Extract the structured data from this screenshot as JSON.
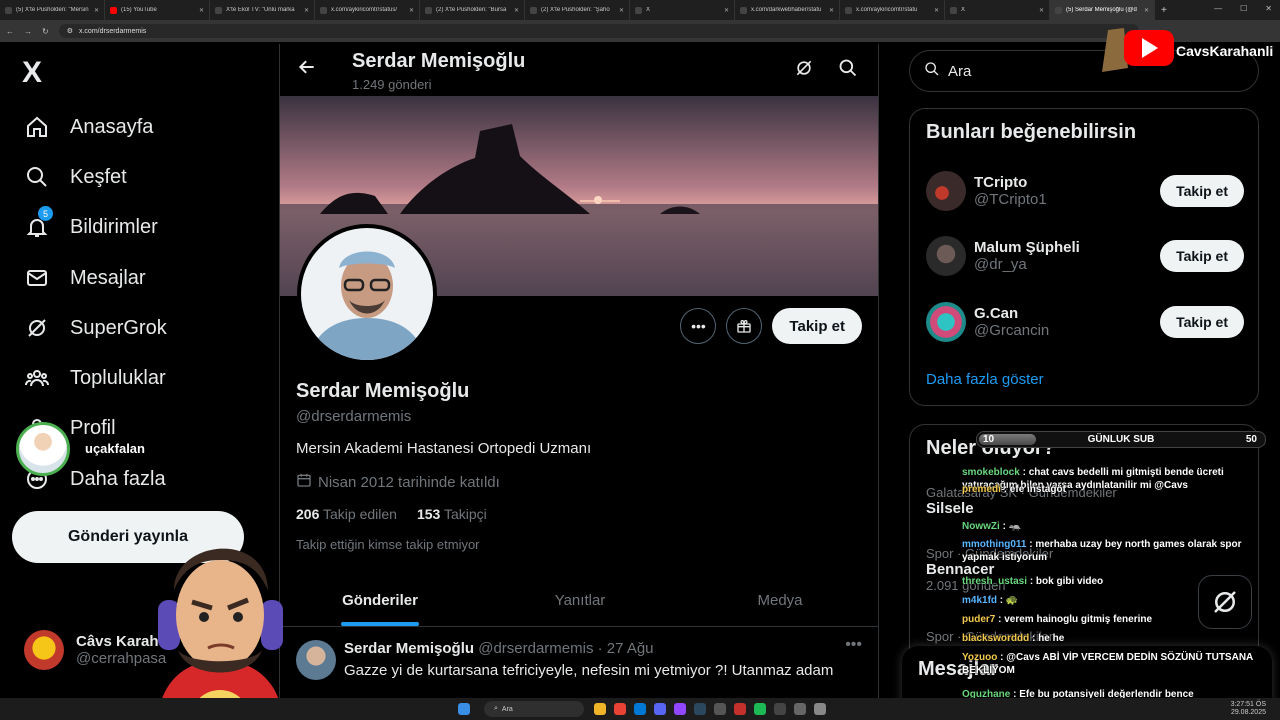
{
  "browser": {
    "tabs": [
      {
        "title": "(5) X'te Pusholden: \"Mersin",
        "fav": "#444"
      },
      {
        "title": "(15) YouTube",
        "fav": "#ff0000"
      },
      {
        "title": "X'te Ekol TV: \"Ünlü marka",
        "fav": "#444"
      },
      {
        "title": "x.com/aykiricomtr/status/",
        "fav": "#444"
      },
      {
        "title": "(2) X'te Pusholden: \"Bursa",
        "fav": "#444"
      },
      {
        "title": "(2) X'te Pusholden: \"Şaho",
        "fav": "#444"
      },
      {
        "title": "X",
        "fav": "#444"
      },
      {
        "title": "x.com/darkwebhaber/statu",
        "fav": "#444"
      },
      {
        "title": "x.com/aykiricomtr/statu",
        "fav": "#444"
      },
      {
        "title": "X",
        "fav": "#444"
      },
      {
        "title": "(5) Serdar Memişoğlu (@d",
        "fav": "#444"
      }
    ],
    "new_tab": "+",
    "url": "x.com/drserdarmemis"
  },
  "leftnav": {
    "logo": "X",
    "items": [
      {
        "label": "Anasayfa",
        "icon": "home-icon"
      },
      {
        "label": "Keşfet",
        "icon": "search-icon"
      },
      {
        "label": "Bildirimler",
        "icon": "bell-icon",
        "badge": "5"
      },
      {
        "label": "Mesajlar",
        "icon": "mail-icon"
      },
      {
        "label": "SuperGrok",
        "icon": "grok-icon"
      },
      {
        "label": "Topluluklar",
        "icon": "communities-icon"
      },
      {
        "label": "Profil",
        "icon": "person-icon"
      },
      {
        "label": "Daha fazla",
        "icon": "more-circle-icon"
      }
    ],
    "post_button": "Gönderi yayınla",
    "account": {
      "name": "Câvs Karah",
      "handle": "@cerrahpasa"
    }
  },
  "overlay": {
    "viewer_name": "uçakfalan",
    "yt_channel": "CavsKarahanli",
    "sub_goal": {
      "current": "10",
      "label": "GÜNLUK SUB",
      "target": "50",
      "progress": 0.2
    },
    "chat": [
      {
        "user": "smokeblock",
        "msg": ": chat cavs bedelli mi gitmişti bende ücreti yatıracağım bilen varsa aydınlatanilir mi @Cavs",
        "color": "g"
      },
      {
        "user": "premedi",
        "msg": ": efe instagöt",
        "color": ""
      },
      {
        "user": "NowwZi",
        "msg": ": 🦡",
        "color": "g"
      },
      {
        "user": "mmothing011",
        "msg": ": merhaba uzay bey north games olarak spor yapmak istiyorum",
        "color": "b"
      },
      {
        "user": "thresh_ustasi",
        "msg": ": bok gibi video",
        "color": "g"
      },
      {
        "user": "m4k1fd",
        "msg": ": 🐢",
        "color": "b"
      },
      {
        "user": "puder7",
        "msg": ": verem hainoglu gitmiş fenerine",
        "color": ""
      },
      {
        "user": "blacksworddd",
        "msg": ": he he",
        "color": ""
      },
      {
        "user": "Yozuoo",
        "msg": ": @Cavs ABİ VİP VERCEM DEDİN SÖZÜNÜ TUTSANA BEKLİYOM",
        "color": ""
      },
      {
        "user": "Oguzhane",
        "msg": ": Efe bu potansiyeli değerlendir bence",
        "color": "g"
      }
    ]
  },
  "profile": {
    "header_name": "Serdar Memişoğlu",
    "post_count": "1.249 gönderi",
    "display_name": "Serdar Memişoğlu",
    "handle": "@drserdarmemis",
    "bio": "Mersin Akademi Hastanesi Ortopedi Uzmanı",
    "joined": "Nisan 2012 tarihinde katıldı",
    "following_count": "206",
    "following_label": "Takip edilen",
    "followers_count": "153",
    "followers_label": "Takipçi",
    "no_mutuals": "Takip ettiğin kimse takip etmiyor",
    "follow_button": "Takip et",
    "tabs": [
      "Gönderiler",
      "Yanıtlar",
      "Medya"
    ]
  },
  "tweet": {
    "name": "Serdar Memişoğlu",
    "handle": "@drserdarmemis",
    "date": "· 27 Ağu",
    "text": "Gazze yi de kurtarsana tefriciyeyle, nefesin mi yetmiyor ?! Utanmaz adam"
  },
  "right": {
    "search_placeholder": "Ara",
    "suggest_title": "Bunları beğenebilirsin",
    "suggestions": [
      {
        "name": "TCripto",
        "handle": "@TCripto1",
        "button": "Takip et"
      },
      {
        "name": "Malum Şüpheli",
        "handle": "@dr_ya",
        "button": "Takip et"
      },
      {
        "name": "G.Can",
        "handle": "@Grcancin",
        "button": "Takip et"
      }
    ],
    "show_more": "Daha fazla göster",
    "trends_title": "Neler oluyor?",
    "trends": [
      {
        "context": "Galatasaray SK · Gündemdekiler",
        "name": "Silsele",
        "posts": ""
      },
      {
        "context": "Spor · Gündemdekiler",
        "name": "Bennacer",
        "posts": "2.091 gönderi"
      },
      {
        "context": "Spor · Gündemdekiler",
        "name": "",
        "posts": ""
      }
    ],
    "messages": "Mesajlar"
  },
  "taskbar": {
    "search": "Ara",
    "time": "3:27:51 ÖS",
    "date": "29.08.2025"
  }
}
